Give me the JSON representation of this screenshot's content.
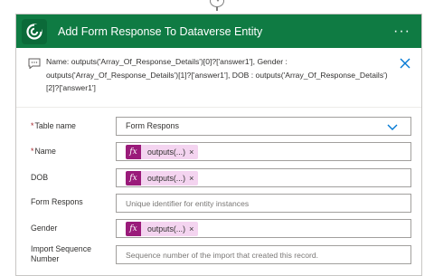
{
  "card": {
    "title": "Add Form Response To Dataverse Entity",
    "more_label": "···"
  },
  "note": {
    "lines": [
      "Name: outputs('Array_Of_Response_Details')[0]?['answer1'], Gender :",
      "outputs('Array_Of_Response_Details')[1]?['answer1'], DOB : outputs('Array_Of_Response_Details')",
      "[2]?['answer1']"
    ]
  },
  "form": {
    "table_name": {
      "label": "Table name",
      "required": "*",
      "value": "Form Respons"
    },
    "name": {
      "label": "Name",
      "required": "*",
      "token_fx": "fx",
      "token_label": "outputs(...)",
      "token_remove": "×"
    },
    "dob": {
      "label": "DOB",
      "token_fx": "fx",
      "token_label": "outputs(...)",
      "token_remove": "×"
    },
    "form_respons": {
      "label": "Form Respons",
      "placeholder": "Unique identifier for entity instances"
    },
    "gender": {
      "label": "Gender",
      "token_fx": "fx",
      "token_label": "outputs(...)",
      "token_remove": "×"
    },
    "import_seq": {
      "label": "Import Sequence Number",
      "placeholder": "Sequence number of the import that created this record."
    }
  },
  "colors": {
    "header": "#0f7b43",
    "token_fx": "#9a1b7a",
    "token_bg": "#f4d4f0",
    "accent": "#0078d4",
    "required": "#a4262c"
  },
  "icons": [
    "dataverse-logo-icon",
    "note-icon",
    "close-icon",
    "chevron-down-icon",
    "arrow-down-icon"
  ]
}
